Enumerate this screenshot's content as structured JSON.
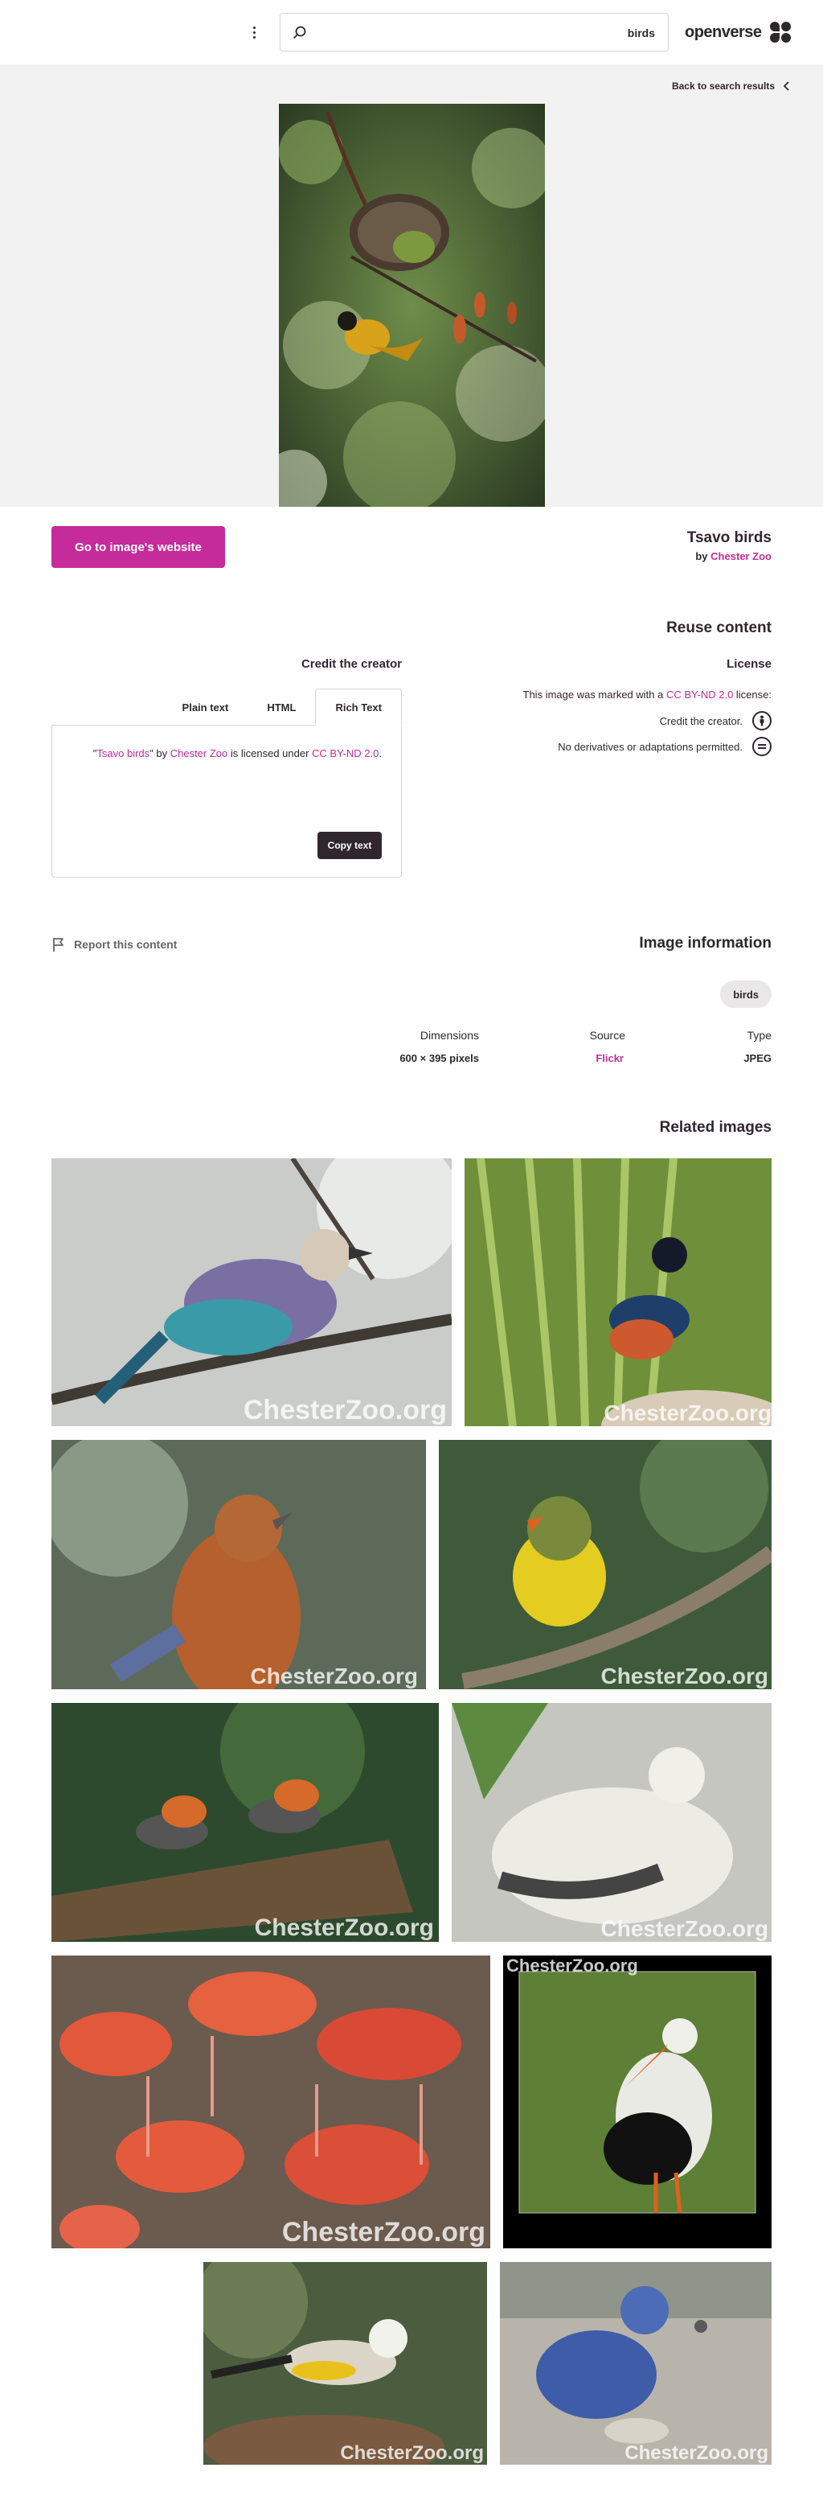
{
  "header": {
    "search_value": "birds",
    "brand_name": "openverse",
    "icons": {
      "menu": "kebab-menu-icon",
      "search": "search-icon",
      "logo": "openverse-logo-icon"
    }
  },
  "hero": {
    "back_label": "Back to search results",
    "icon": "chevron-left-icon"
  },
  "image": {
    "title": "Tsavo birds",
    "by": "by",
    "creator": "Chester Zoo",
    "go_button": "Go to image's website"
  },
  "reuse": {
    "heading": "Reuse content",
    "credit_heading": "Credit the creator",
    "tabs": [
      "Plain text",
      "HTML",
      "Rich Text"
    ],
    "active_tab": "Rich Text",
    "credit": {
      "open_quote": "\"",
      "title": "Tsavo birds",
      "by": "\" by ",
      "creator": "Chester Zoo",
      "licensed": " is licensed under ",
      "license": "CC BY-ND 2.0",
      "close": "."
    },
    "copy_button": "Copy text",
    "license_heading": "License",
    "license_line": {
      "prefix": "This image was marked with a ",
      "license": "CC BY-ND 2.0",
      "suffix": " license:"
    },
    "license_terms": [
      {
        "text": "Credit the creator.",
        "icon": "by-attribution-icon"
      },
      {
        "text": "No derivatives or adaptations permitted.",
        "icon": "nd-no-derivatives-icon"
      }
    ]
  },
  "info": {
    "report_label": "Report this content",
    "report_icon": "flag-icon",
    "heading": "Image information",
    "tag": "birds",
    "labels": {
      "type": "Type",
      "source": "Source",
      "dimensions": "Dimensions"
    },
    "values": {
      "type": "JPEG",
      "source": "Flickr",
      "dimensions": "600 × 395 pixels"
    }
  },
  "related": {
    "heading": "Related images",
    "watermark": "ChesterZoo.org",
    "items": [
      {
        "subject": "lilac-breasted roller on branch"
      },
      {
        "subject": "superb starling"
      },
      {
        "subject": "orange-headed thrush"
      },
      {
        "subject": "yellow-breasted bird on branch"
      },
      {
        "subject": "two laughingthrushes on wood"
      },
      {
        "subject": "white imperial pigeon"
      },
      {
        "subject": "flock of flamingos"
      },
      {
        "subject": "white stork on grass"
      },
      {
        "subject": "finch on rock"
      },
      {
        "subject": "victoria crowned pigeon"
      }
    ]
  },
  "colors": {
    "accent": "#c52b9b",
    "text": "#30272e",
    "hero_bg": "#f3f2f2"
  }
}
